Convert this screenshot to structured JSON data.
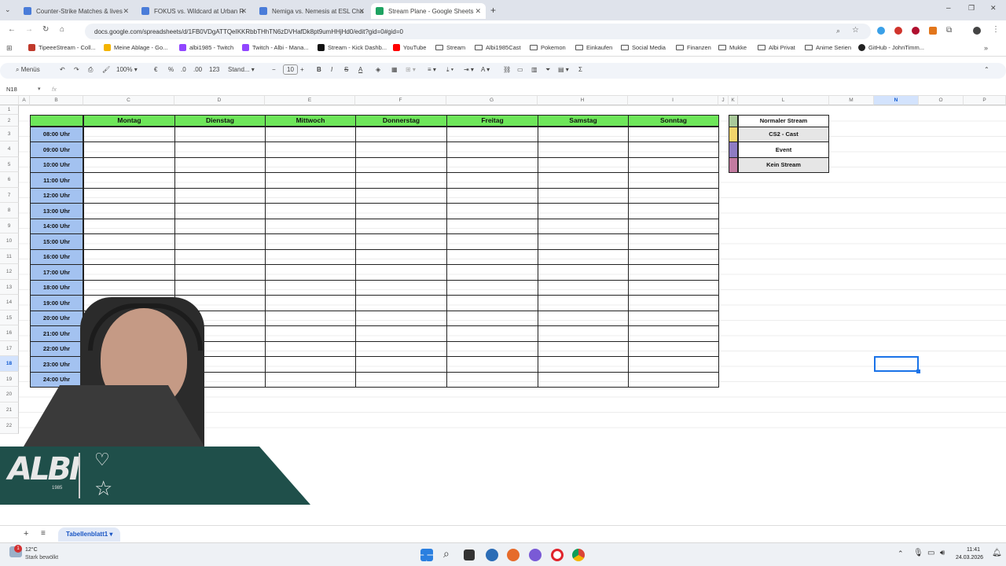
{
  "browser": {
    "tabs": [
      {
        "title": "Counter-Strike Matches & lives",
        "color": "#4a7cd9"
      },
      {
        "title": "FOKUS vs. Wildcard at Urban R",
        "color": "#4a7cd9"
      },
      {
        "title": "Nemiga vs. Nemesis at ESL Cha",
        "color": "#4a7cd9"
      },
      {
        "title": "Stream Plane - Google Sheets",
        "color": "#1ea362"
      }
    ],
    "url": "docs.google.com/spreadsheets/d/1FB0VDgATTQeIKKRbbTHhTN6zDVHafDk8pt9umHHjHd0/edit?gid=0#gid=0",
    "bookmarks": [
      "TipeeeStream - Coll...",
      "Meine Ablage - Go...",
      "albi1985 - Twitch",
      "Twitch - Albi - Mana...",
      "Stream - Kick Dashb...",
      "YouTube",
      "Stream",
      "Albi1985Cast",
      "Pokemon",
      "Einkaufen",
      "Social Media",
      "Finanzen",
      "Mukke",
      "Albi Privat",
      "Anime Serien",
      "GitHub - JohnTimm..."
    ]
  },
  "toolbar": {
    "menus": "Menüs",
    "zoom": "100%",
    "currency": "€",
    "percent": "%",
    "dec_less": ".0",
    "dec_more": ".00",
    "number_format": "123",
    "font": "Stand...",
    "font_size": "10",
    "bold": "B",
    "italic": "I",
    "underline_text": "A",
    "sigma": "Σ"
  },
  "formula": {
    "cell_ref": "N18",
    "fx": "fx"
  },
  "columns": [
    "A",
    "B",
    "C",
    "D",
    "E",
    "F",
    "G",
    "H",
    "I",
    "J",
    "K",
    "L",
    "M",
    "N",
    "O",
    "P"
  ],
  "rows": [
    "1",
    "2",
    "3",
    "4",
    "5",
    "6",
    "7",
    "8",
    "9",
    "10",
    "11",
    "12",
    "13",
    "14",
    "15",
    "16",
    "17",
    "18",
    "19",
    "20",
    "21",
    "22"
  ],
  "schedule": {
    "days": [
      "Montag",
      "Dienstag",
      "Mittwoch",
      "Donnerstag",
      "Freitag",
      "Samstag",
      "Sonntag"
    ],
    "times": [
      "08:00 Uhr",
      "09:00 Uhr",
      "10:00 Uhr",
      "11:00 Uhr",
      "12:00 Uhr",
      "13:00 Uhr",
      "14:00 Uhr",
      "15:00 Uhr",
      "16:00 Uhr",
      "17:00 Uhr",
      "18:00 Uhr",
      "19:00 Uhr",
      "20:00 Uhr",
      "21:00 Uhr",
      "22:00 Uhr",
      "23:00 Uhr",
      "24:00 Uhr"
    ],
    "header_color": "#6ee65a",
    "time_color": "#a3c2f0"
  },
  "legend": [
    {
      "label": "Normaler Stream",
      "color": "#a9c99a",
      "bg": "#ffffff"
    },
    {
      "label": "CS2 - Cast",
      "color": "#f3d56b",
      "bg": "#e6e6e6"
    },
    {
      "label": "Event",
      "color": "#8e7cc3",
      "bg": "#ffffff"
    },
    {
      "label": "Kein Stream",
      "color": "#c27ba0",
      "bg": "#e6e6e6"
    }
  ],
  "sheet": {
    "tab_name": "Tabellenblatt1",
    "add": "+",
    "list": "≡"
  },
  "taskbar": {
    "temperature": "12°C",
    "weather": "Stark bewölkt",
    "badge": "1",
    "time": "11:41",
    "date": "24.03.2026"
  },
  "overlay": {
    "logo_text": "ALBI",
    "logo_year": "1985"
  }
}
